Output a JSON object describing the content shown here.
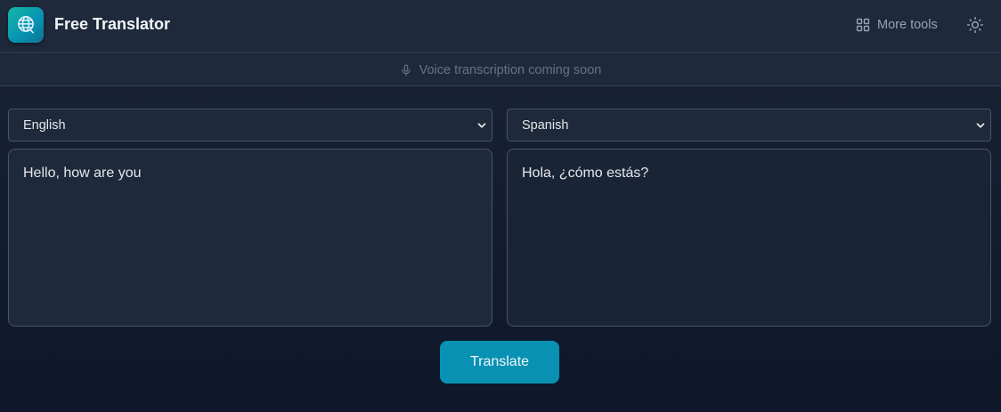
{
  "header": {
    "title": "Free Translator",
    "more_tools_label": "More tools",
    "logo_icon": "globe-icon",
    "theme_icon": "sun-icon"
  },
  "notice": {
    "text": "Voice transcription coming soon",
    "icon": "microphone-icon"
  },
  "source": {
    "language": "English",
    "text": "Hello, how are you"
  },
  "target": {
    "language": "Spanish",
    "text": "Hola, ¿cómo estás?"
  },
  "actions": {
    "translate_label": "Translate"
  },
  "colors": {
    "accent": "#0891b2",
    "logo_gradient_start": "#14b8a6",
    "background": "#0f172a",
    "panel": "#1e293b"
  }
}
